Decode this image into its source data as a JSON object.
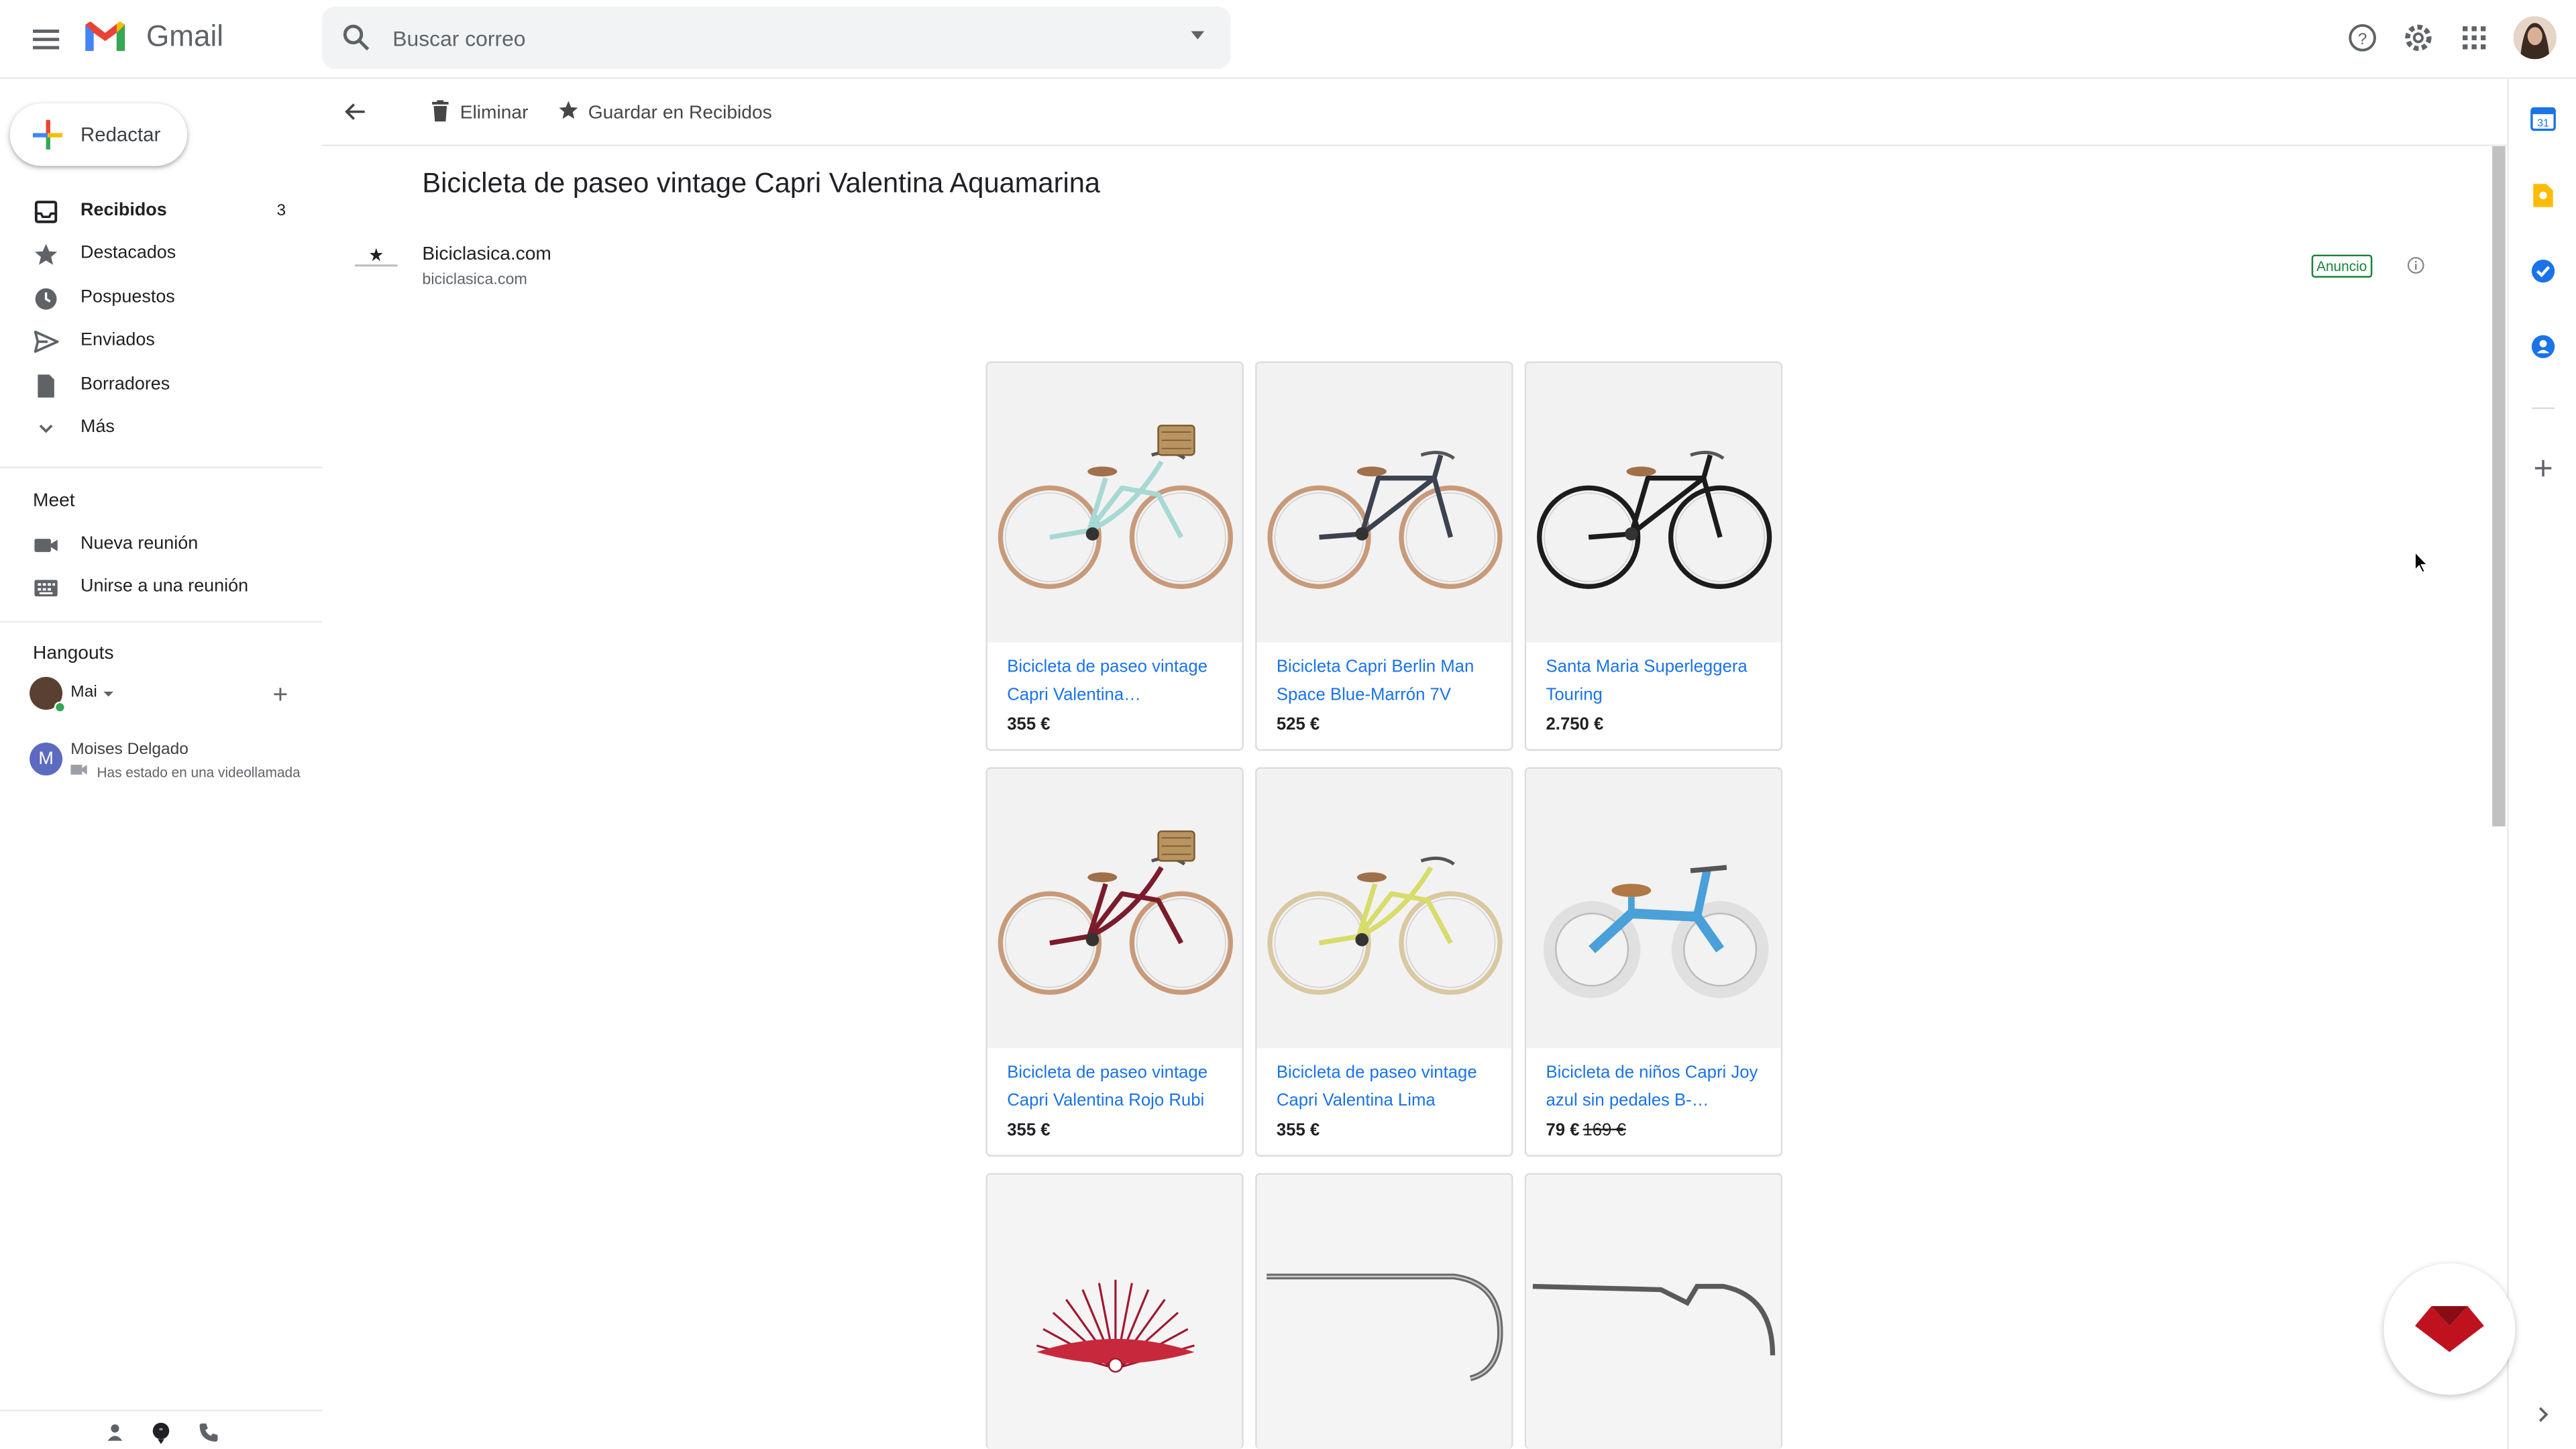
{
  "app": {
    "brand": "Gmail"
  },
  "search": {
    "placeholder": "Buscar correo"
  },
  "compose": {
    "label": "Redactar"
  },
  "sidebar": {
    "items": [
      {
        "label": "Recibidos",
        "count": "3",
        "icon": "inbox-icon"
      },
      {
        "label": "Destacados",
        "icon": "star-icon"
      },
      {
        "label": "Pospuestos",
        "icon": "clock-icon"
      },
      {
        "label": "Enviados",
        "icon": "send-icon"
      },
      {
        "label": "Borradores",
        "icon": "draft-icon"
      },
      {
        "label": "Más",
        "icon": "chevron-down-icon"
      }
    ],
    "meet": {
      "title": "Meet",
      "items": [
        {
          "label": "Nueva reunión",
          "icon": "video-icon"
        },
        {
          "label": "Unirse a una reunión",
          "icon": "keyboard-icon"
        }
      ]
    },
    "hangouts": {
      "title": "Hangouts",
      "user": "Mai",
      "contacts": [
        {
          "initial": "M",
          "name": "Moises Delgado",
          "status": "Has estado en una videollamada"
        }
      ]
    }
  },
  "toolbar": {
    "delete_label": "Eliminar",
    "save_label": "Guardar en Recibidos"
  },
  "message": {
    "subject": "Bicicleta de paseo vintage Capri Valentina Aquamarina",
    "sender_name": "Biciclasica.com",
    "sender_domain": "biciclasica.com",
    "ad_badge": "Anuncio"
  },
  "products": [
    {
      "title": "Bicicleta de paseo vintage Capri Valentina…",
      "price": "355 €",
      "frame_color": "#a8d8d4",
      "basket": true
    },
    {
      "title": "Bicicleta Capri Berlin Man Space Blue-Marrón 7V",
      "price": "525 €",
      "frame_color": "#3c4250",
      "basket": false
    },
    {
      "title": "Santa Maria Superleggera Touring",
      "price": "2.750 €",
      "frame_color": "#1c1c1c",
      "basket": false
    },
    {
      "title": "Bicicleta de paseo vintage Capri Valentina Rojo Rubi",
      "price": "355 €",
      "frame_color": "#7a1c2c",
      "basket": true
    },
    {
      "title": "Bicicleta de paseo vintage Capri Valentina Lima",
      "price": "355 €",
      "frame_color": "#d8dc6a",
      "basket": false
    },
    {
      "title": "Bicicleta de niños Capri Joy azul sin pedales B-…",
      "price": "79 €",
      "old_price": "169 €",
      "frame_color": "#4aa0d8",
      "basket": false
    }
  ],
  "colors": {
    "accent": "#1a73e8",
    "ad": "#188038",
    "gmail_red": "#ea4335"
  }
}
